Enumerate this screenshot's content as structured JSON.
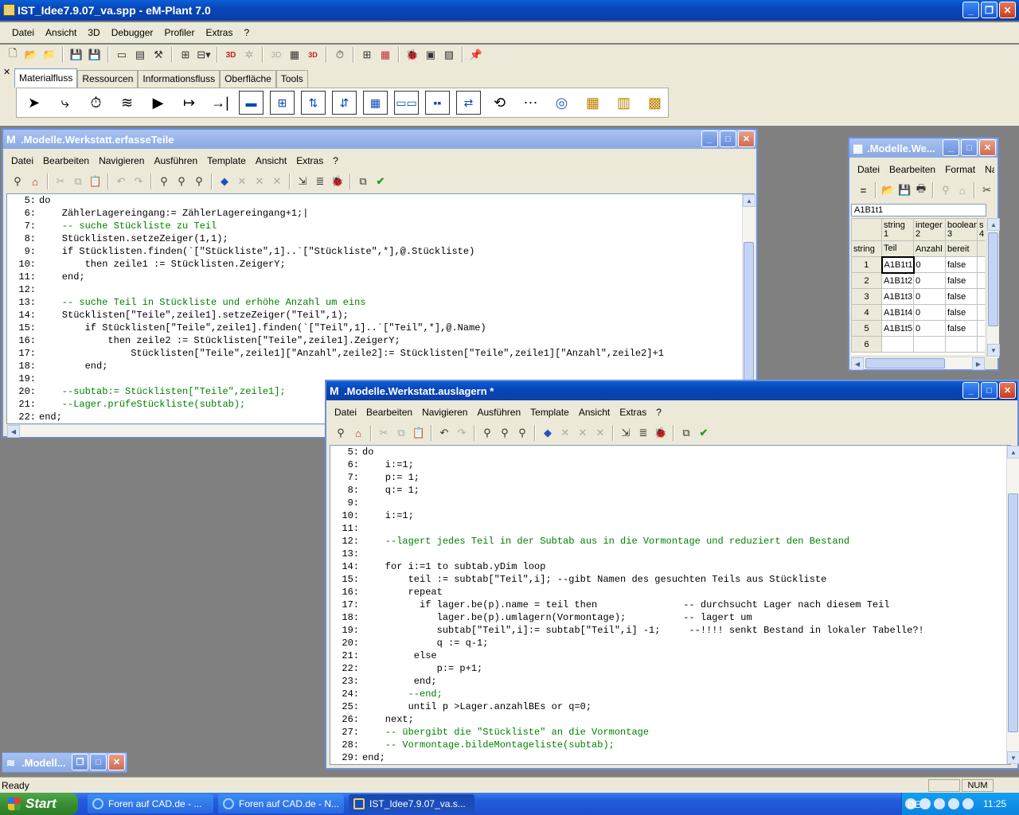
{
  "app": {
    "title": "IST_Idee7.9.07_va.spp - eM-Plant 7.0",
    "menu": [
      "Datei",
      "Ansicht",
      "3D",
      "Debugger",
      "Profiler",
      "Extras",
      "?"
    ]
  },
  "library": {
    "tabs": [
      "Materialfluss",
      "Ressourcen",
      "Informationsfluss",
      "Oberfläche",
      "Tools"
    ],
    "active_tab": "Materialfluss"
  },
  "win1": {
    "title": ".Modelle.Werkstatt.erfasseTeile",
    "menu": [
      "Datei",
      "Bearbeiten",
      "Navigieren",
      "Ausführen",
      "Template",
      "Ansicht",
      "Extras",
      "?"
    ],
    "lines": [
      {
        "n": "5:",
        "t": "do"
      },
      {
        "n": "6:",
        "t": "    ZählerLagereingang:= ZählerLagereingang+1;|"
      },
      {
        "n": "7:",
        "t": "    -- suche Stückliste zu Teil"
      },
      {
        "n": "8:",
        "t": "    Stücklisten.setzeZeiger(1,1);"
      },
      {
        "n": "9:",
        "t": "    if Stücklisten.finden(`[\"Stückliste\",1]..`[\"Stückliste\",*],@.Stückliste)"
      },
      {
        "n": "10:",
        "t": "        then zeile1 := Stücklisten.ZeigerY;"
      },
      {
        "n": "11:",
        "t": "    end;"
      },
      {
        "n": "12:",
        "t": ""
      },
      {
        "n": "13:",
        "t": "    -- suche Teil in Stückliste und erhöhe Anzahl um eins"
      },
      {
        "n": "14:",
        "t": "    Stücklisten[\"Teile\",zeile1].setzeZeiger(\"Teil\",1);"
      },
      {
        "n": "15:",
        "t": "        if Stücklisten[\"Teile\",zeile1].finden(`[\"Teil\",1]..`[\"Teil\",*],@.Name)"
      },
      {
        "n": "16:",
        "t": "            then zeile2 := Stücklisten[\"Teile\",zeile1].ZeigerY;"
      },
      {
        "n": "17:",
        "t": "                Stücklisten[\"Teile\",zeile1][\"Anzahl\",zeile2]:= Stücklisten[\"Teile\",zeile1][\"Anzahl\",zeile2]+1"
      },
      {
        "n": "18:",
        "t": "        end;"
      },
      {
        "n": "19:",
        "t": ""
      },
      {
        "n": "20:",
        "t": "    --subtab:= Stücklisten[\"Teile\",zeile1];"
      },
      {
        "n": "21:",
        "t": "    --Lager.prüfeStückliste(subtab);"
      },
      {
        "n": "22:",
        "t": "end;"
      }
    ]
  },
  "win2": {
    "title": ".Modelle.Werkstatt.auslagern *",
    "menu": [
      "Datei",
      "Bearbeiten",
      "Navigieren",
      "Ausführen",
      "Template",
      "Ansicht",
      "Extras",
      "?"
    ],
    "lines": [
      {
        "n": "5:",
        "t": "do"
      },
      {
        "n": "6:",
        "t": "    i:=1;"
      },
      {
        "n": "7:",
        "t": "    p:= 1;"
      },
      {
        "n": "8:",
        "t": "    q:= 1;"
      },
      {
        "n": "9:",
        "t": ""
      },
      {
        "n": "10:",
        "t": "    i:=1;"
      },
      {
        "n": "11:",
        "t": ""
      },
      {
        "n": "12:",
        "t": "    --lagert jedes Teil in der Subtab aus in die Vormontage und reduziert den Bestand"
      },
      {
        "n": "13:",
        "t": ""
      },
      {
        "n": "14:",
        "t": "    for i:=1 to subtab.yDim loop"
      },
      {
        "n": "15:",
        "t": "        teil := subtab[\"Teil\",i]; --gibt Namen des gesuchten Teils aus Stückliste"
      },
      {
        "n": "16:",
        "t": "        repeat"
      },
      {
        "n": "17:",
        "t": "          if lager.be(p).name = teil then               -- durchsucht Lager nach diesem Teil"
      },
      {
        "n": "18:",
        "t": "             lager.be(p).umlagern(Vormontage);          -- lagert um"
      },
      {
        "n": "19:",
        "t": "             subtab[\"Teil\",i]:= subtab[\"Teil\",i] -1;     --!!!! senkt Bestand in lokaler Tabelle?!"
      },
      {
        "n": "20:",
        "t": "             q := q-1;"
      },
      {
        "n": "21:",
        "t": "         else"
      },
      {
        "n": "22:",
        "t": "             p:= p+1;"
      },
      {
        "n": "23:",
        "t": "         end;"
      },
      {
        "n": "24:",
        "t": "        --end;"
      },
      {
        "n": "25:",
        "t": "        until p >Lager.anzahlBEs or q=0;"
      },
      {
        "n": "26:",
        "t": "    next;"
      },
      {
        "n": "27:",
        "t": "    -- übergibt die \"Stückliste\" an die Vormontage"
      },
      {
        "n": "28:",
        "t": "    -- Vormontage.bildeMontageliste(subtab);"
      },
      {
        "n": "29:",
        "t": "end;"
      }
    ]
  },
  "win3": {
    "title": ".Modelle.We...",
    "menu": [
      "Datei",
      "Bearbeiten",
      "Format",
      "Navigie"
    ],
    "cell_ref": "A1B1t1",
    "col_types": [
      "string",
      "integer",
      "boolean",
      "s"
    ],
    "col_nums": [
      "1",
      "2",
      "3",
      "4"
    ],
    "col_names": [
      "Teil",
      "Anzahl",
      "bereit"
    ],
    "row_type": "string",
    "rows": [
      {
        "idx": "1",
        "teil": "A1B1t1",
        "anzahl": "0",
        "bereit": "false"
      },
      {
        "idx": "2",
        "teil": "A1B1t2",
        "anzahl": "0",
        "bereit": "false"
      },
      {
        "idx": "3",
        "teil": "A1B1t3",
        "anzahl": "0",
        "bereit": "false"
      },
      {
        "idx": "4",
        "teil": "A1B1t4",
        "anzahl": "0",
        "bereit": "false"
      },
      {
        "idx": "5",
        "teil": "A1B1t5",
        "anzahl": "0",
        "bereit": "false"
      },
      {
        "idx": "6",
        "teil": "",
        "anzahl": "",
        "bereit": ""
      }
    ]
  },
  "minimized": ".Modell...",
  "status": {
    "text": "Ready",
    "num": "NUM"
  },
  "taskbar": {
    "start": "Start",
    "tasks": [
      "Foren auf CAD.de - ...",
      "Foren auf CAD.de - N...",
      "IST_Idee7.9.07_va.s..."
    ],
    "lang": "DE",
    "clock": "11:25"
  }
}
